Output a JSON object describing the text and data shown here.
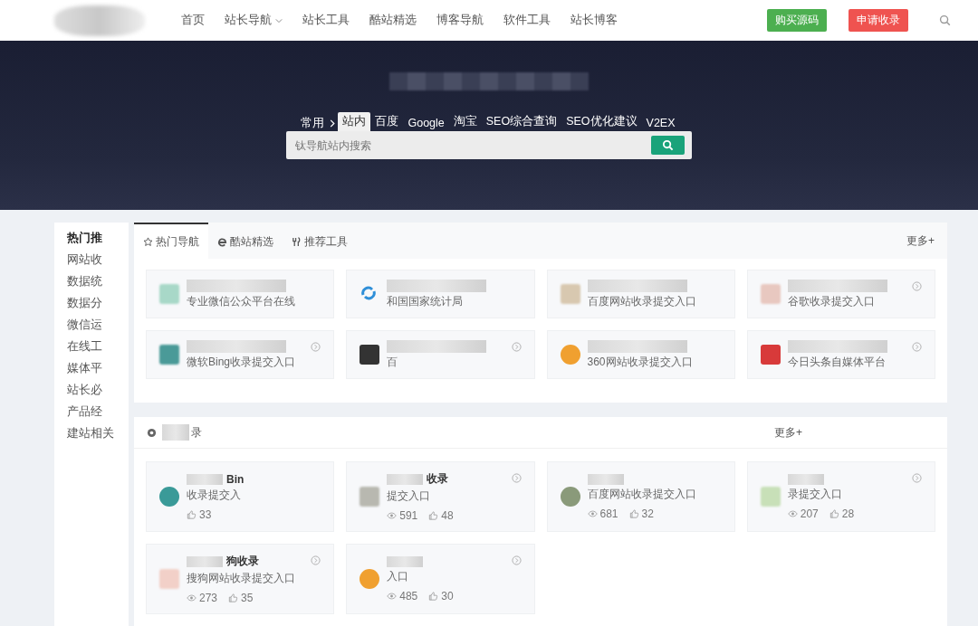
{
  "nav": {
    "items": [
      {
        "label": "首页",
        "dropdown": false
      },
      {
        "label": "站长导航",
        "dropdown": true
      },
      {
        "label": "站长工具",
        "dropdown": false
      },
      {
        "label": "酷站精选",
        "dropdown": false
      },
      {
        "label": "博客导航",
        "dropdown": false
      },
      {
        "label": "软件工具",
        "dropdown": false
      },
      {
        "label": "站长博客",
        "dropdown": false
      }
    ],
    "buttons": [
      {
        "label": "购买源码",
        "color": "#4caf50"
      },
      {
        "label": "申请收录",
        "color": "#ef5350"
      }
    ]
  },
  "search": {
    "group_label": "常用",
    "tabs": [
      {
        "label": "站内",
        "selected": true
      },
      {
        "label": "百度",
        "selected": false
      },
      {
        "label": "Google",
        "selected": false
      },
      {
        "label": "淘宝",
        "selected": false
      },
      {
        "label": "SEO综合查询",
        "selected": false
      },
      {
        "label": "SEO优化建议",
        "selected": false
      },
      {
        "label": "V2EX",
        "selected": false
      }
    ],
    "placeholder": "钛导航站内搜索"
  },
  "sidebar": {
    "items": [
      {
        "label": "热门推",
        "selected": true
      },
      {
        "label": "网站收",
        "selected": false
      },
      {
        "label": "数据统",
        "selected": false
      },
      {
        "label": "数据分",
        "selected": false
      },
      {
        "label": "微信运",
        "selected": false
      },
      {
        "label": "在线工",
        "selected": false
      },
      {
        "label": "媒体平",
        "selected": false
      },
      {
        "label": "站长必",
        "selected": false
      },
      {
        "label": "产品经",
        "selected": false
      },
      {
        "label": "建站相关",
        "selected": false
      }
    ]
  },
  "hot": {
    "tabs": [
      {
        "label": "热门导航",
        "kind": "star",
        "selected": true
      },
      {
        "label": "酷站精选",
        "kind": "browser",
        "selected": false
      },
      {
        "label": "推荐工具",
        "kind": "cutlery",
        "selected": false
      }
    ],
    "more": "更多+",
    "cards": [
      {
        "icon": {
          "kind": "blur",
          "color": "#a8d8c8"
        },
        "desc": "专业微信公众平台在线",
        "arrow": false
      },
      {
        "icon": {
          "kind": "swirl",
          "color": "#2f8fd8"
        },
        "desc": "和国国家统计局",
        "arrow": false
      },
      {
        "icon": {
          "kind": "blur",
          "color": "#d8c8b0"
        },
        "desc": "百度网站收录提交入口",
        "arrow": false
      },
      {
        "icon": {
          "kind": "blur",
          "color": "#e8c8c0"
        },
        "desc": "谷歌收录提交入口",
        "arrow": true
      },
      {
        "icon": {
          "kind": "blur",
          "color": "#4a9a98"
        },
        "desc": "微软Bing收录提交入口",
        "arrow": true
      },
      {
        "icon": {
          "kind": "square",
          "color": "#333333"
        },
        "desc": "百",
        "arrow": true
      },
      {
        "icon": {
          "kind": "round",
          "color": "#f0a030"
        },
        "desc": "360网站收录提交入口",
        "arrow": false
      },
      {
        "icon": {
          "kind": "square",
          "color": "#d83a3a"
        },
        "desc": "今日头条自媒体平台",
        "arrow": true
      }
    ]
  },
  "collect": {
    "title": "录",
    "more": "更多+",
    "cards": [
      {
        "icon": {
          "kind": "round",
          "color": "#3a9a98"
        },
        "title": "Bin",
        "desc": "收录提交入",
        "likes": "33",
        "arrow": false
      },
      {
        "icon": {
          "kind": "blur",
          "color": "#b8b8b0"
        },
        "title": "收录",
        "desc": "提交入口",
        "views": "591",
        "likes": "48",
        "arrow": true
      },
      {
        "icon": {
          "kind": "round",
          "color": "#8a9a7a"
        },
        "desc": "百度网站收录提交入口",
        "views": "681",
        "likes": "32",
        "arrow": false
      },
      {
        "icon": {
          "kind": "blur",
          "color": "#c8e0b8"
        },
        "desc": "录提交入口",
        "views": "207",
        "likes": "28",
        "arrow": true
      },
      {
        "icon": {
          "kind": "blur",
          "color": "#f2d0c8"
        },
        "title": "狗收录",
        "desc": "搜狗网站收录提交入口",
        "views": "273",
        "likes": "35",
        "arrow": true
      },
      {
        "icon": {
          "kind": "round",
          "color": "#f0a030"
        },
        "desc": "入口",
        "views": "485",
        "likes": "30",
        "arrow": true
      }
    ]
  }
}
